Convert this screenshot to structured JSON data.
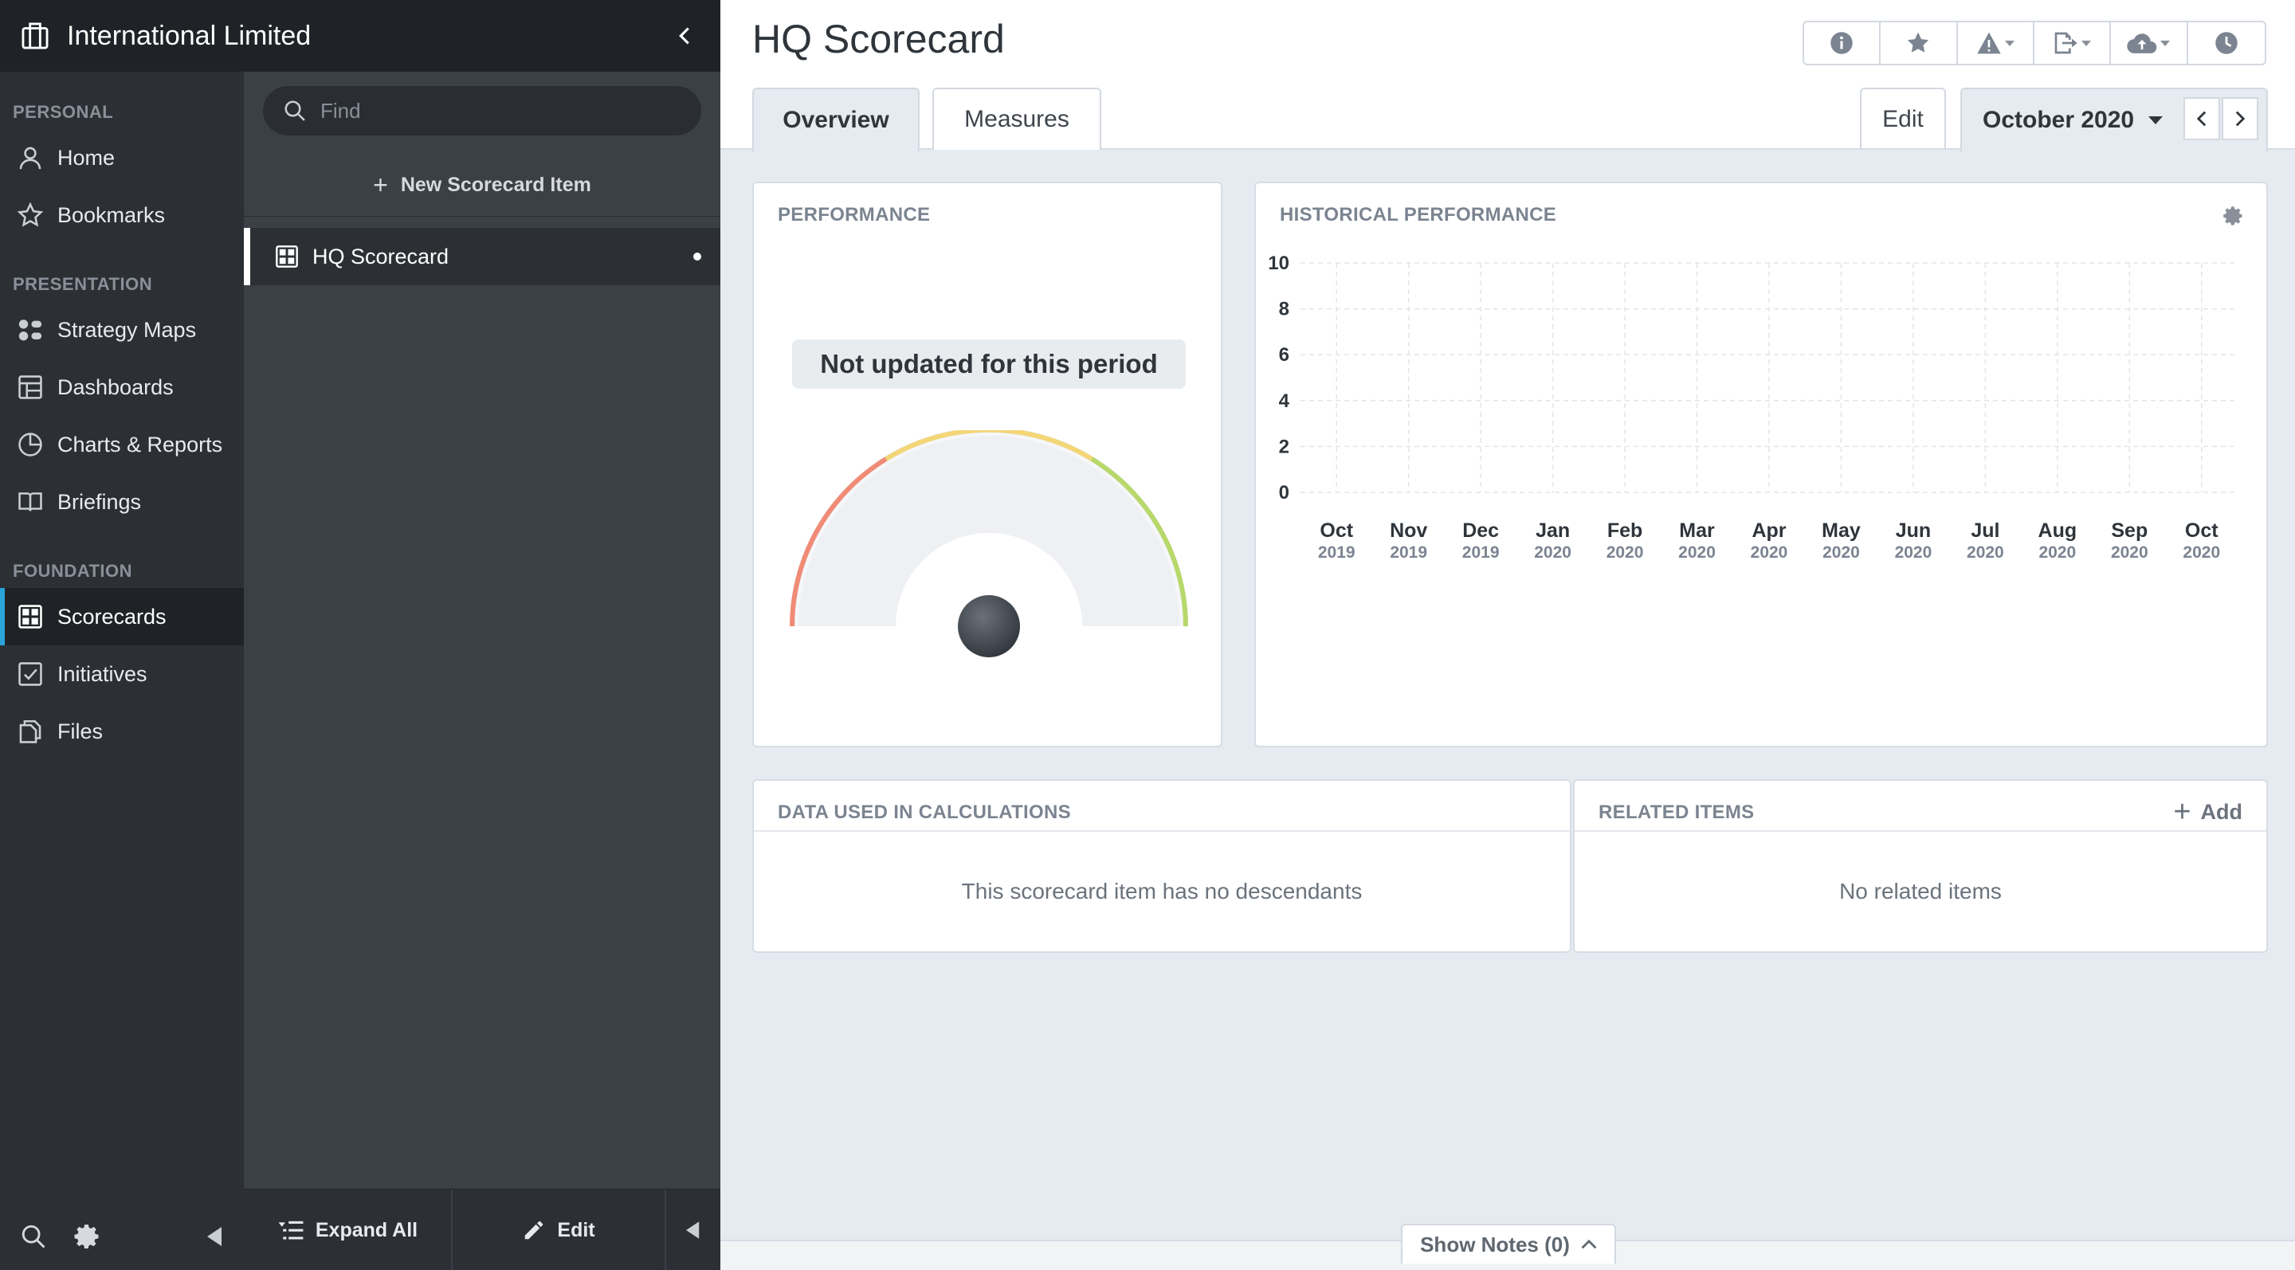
{
  "org": {
    "name": "International Limited",
    "icon": "building-icon"
  },
  "nav": {
    "sections": [
      {
        "label": "PERSONAL"
      },
      {
        "label": "PRESENTATION"
      },
      {
        "label": "FOUNDATION"
      }
    ],
    "items": [
      {
        "label": "Home",
        "icon": "user-icon"
      },
      {
        "label": "Bookmarks",
        "icon": "star-icon"
      },
      {
        "label": "Strategy Maps",
        "icon": "strategy-map-icon"
      },
      {
        "label": "Dashboards",
        "icon": "dashboard-icon"
      },
      {
        "label": "Charts & Reports",
        "icon": "pie-chart-icon"
      },
      {
        "label": "Briefings",
        "icon": "book-icon"
      },
      {
        "label": "Scorecards",
        "icon": "scorecard-icon",
        "active": true
      },
      {
        "label": "Initiatives",
        "icon": "checkbox-icon"
      },
      {
        "label": "Files",
        "icon": "files-icon"
      }
    ],
    "accent_color": "#29a3d9"
  },
  "tree": {
    "search_placeholder": "Find",
    "new_item_label": "New Scorecard Item",
    "selected_item": "HQ Scorecard",
    "expand_all_label": "Expand All",
    "edit_label": "Edit"
  },
  "header": {
    "title": "HQ Scorecard",
    "tabs": [
      {
        "label": "Overview",
        "active": true
      },
      {
        "label": "Measures"
      }
    ],
    "edit_label": "Edit",
    "period": "October 2020",
    "toolbar_icons": [
      "info-icon",
      "star-icon",
      "alert-icon",
      "export-icon",
      "cloud-icon",
      "history-icon"
    ]
  },
  "performance": {
    "title": "PERFORMANCE",
    "status": "Not updated for this period"
  },
  "historical": {
    "title": "HISTORICAL PERFORMANCE"
  },
  "chart_data": {
    "type": "line",
    "title": "",
    "x": [
      {
        "month": "Oct",
        "year": "2019"
      },
      {
        "month": "Nov",
        "year": "2019"
      },
      {
        "month": "Dec",
        "year": "2019"
      },
      {
        "month": "Jan",
        "year": "2020"
      },
      {
        "month": "Feb",
        "year": "2020"
      },
      {
        "month": "Mar",
        "year": "2020"
      },
      {
        "month": "Apr",
        "year": "2020"
      },
      {
        "month": "May",
        "year": "2020"
      },
      {
        "month": "Jun",
        "year": "2020"
      },
      {
        "month": "Jul",
        "year": "2020"
      },
      {
        "month": "Aug",
        "year": "2020"
      },
      {
        "month": "Sep",
        "year": "2020"
      },
      {
        "month": "Oct",
        "year": "2020"
      }
    ],
    "series": [],
    "ylim": [
      0,
      10
    ],
    "yticks": [
      0,
      2,
      4,
      6,
      8,
      10
    ],
    "grid": true,
    "xlabel": "",
    "ylabel": ""
  },
  "data_used": {
    "title": "DATA USED IN CALCULATIONS",
    "empty": "This scorecard item has no descendants"
  },
  "related": {
    "title": "RELATED ITEMS",
    "add_label": "Add",
    "empty": "No related items"
  },
  "notes": {
    "label": "Show Notes (0)"
  }
}
